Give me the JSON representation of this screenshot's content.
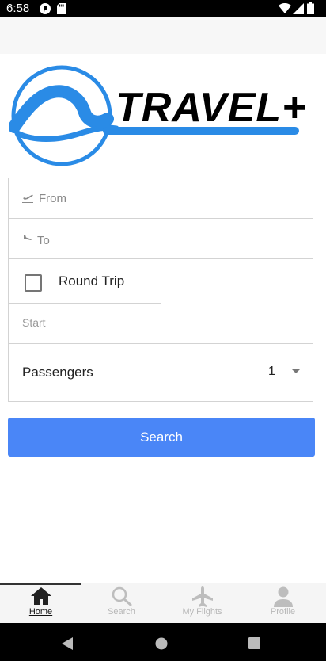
{
  "status": {
    "time": "6:58"
  },
  "logo": {
    "text": "TRAVEL+"
  },
  "form": {
    "from_placeholder": "From",
    "to_placeholder": "To",
    "round_trip_label": "Round Trip",
    "start_placeholder": "Start",
    "passengers_label": "Passengers",
    "passengers_value": "1"
  },
  "search_button": {
    "label": "Search"
  },
  "tabs": [
    {
      "label": "Home",
      "active": true,
      "icon": "home-icon"
    },
    {
      "label": "Search",
      "active": false,
      "icon": "search-icon"
    },
    {
      "label": "My Flights",
      "active": false,
      "icon": "airplane-icon"
    },
    {
      "label": "Profile",
      "active": false,
      "icon": "person-icon"
    }
  ],
  "colors": {
    "accent": "#4a86f7",
    "logo_blue": "#2a8be6"
  }
}
